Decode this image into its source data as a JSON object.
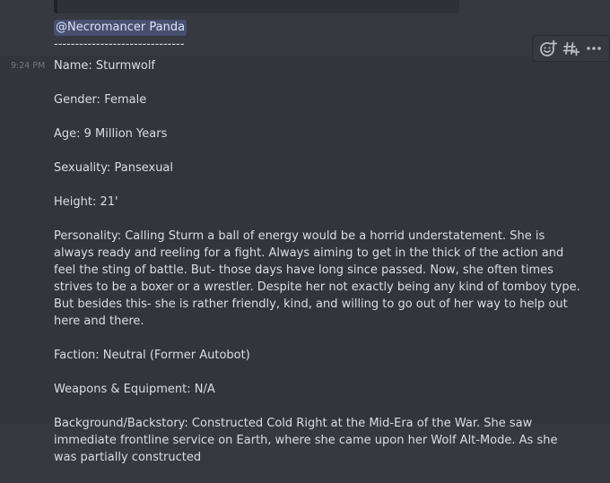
{
  "mention": "@Necromancer Panda",
  "divider": "-------------------------------",
  "message": {
    "timestamp": "9:24 PM",
    "lines": {
      "name": "Name: Sturmwolf",
      "gender": "Gender: Female",
      "age": "Age: 9 Million Years",
      "sexuality": "Sexuality: Pansexual",
      "height": "Height: 21'",
      "personality": "Personality: Calling Sturm a ball of energy would be a horrid understatement. She is always ready and reeling for a fight. Always aiming to get in the thick of the action and feel the sting of battle. But- those days have long since passed. Now, she often times strives to be a boxer or a wrestler. Despite her not exactly being any kind of tomboy type. But besides this- she is rather friendly, kind, and willing to go out of her way to help out here and there.",
      "faction": "Faction: Neutral (Former Autobot)",
      "weapons": "Weapons & Equipment: N/A",
      "background": "Background/Backstory: Constructed Cold Right at the Mid-Era of the War. She saw immediate frontline service on Earth, where she came upon her Wolf Alt-Mode. As she was partially constructed"
    }
  },
  "toolbar": {
    "icons": [
      "add-reaction-icon",
      "create-thread-icon",
      "more-options-icon"
    ]
  },
  "colors": {
    "background": "#36393f",
    "hover_background": "#32353b",
    "text": "#dcddde",
    "timestamp": "#72767d",
    "mention_bg": "#414675",
    "mention_text": "#dee0fc"
  }
}
